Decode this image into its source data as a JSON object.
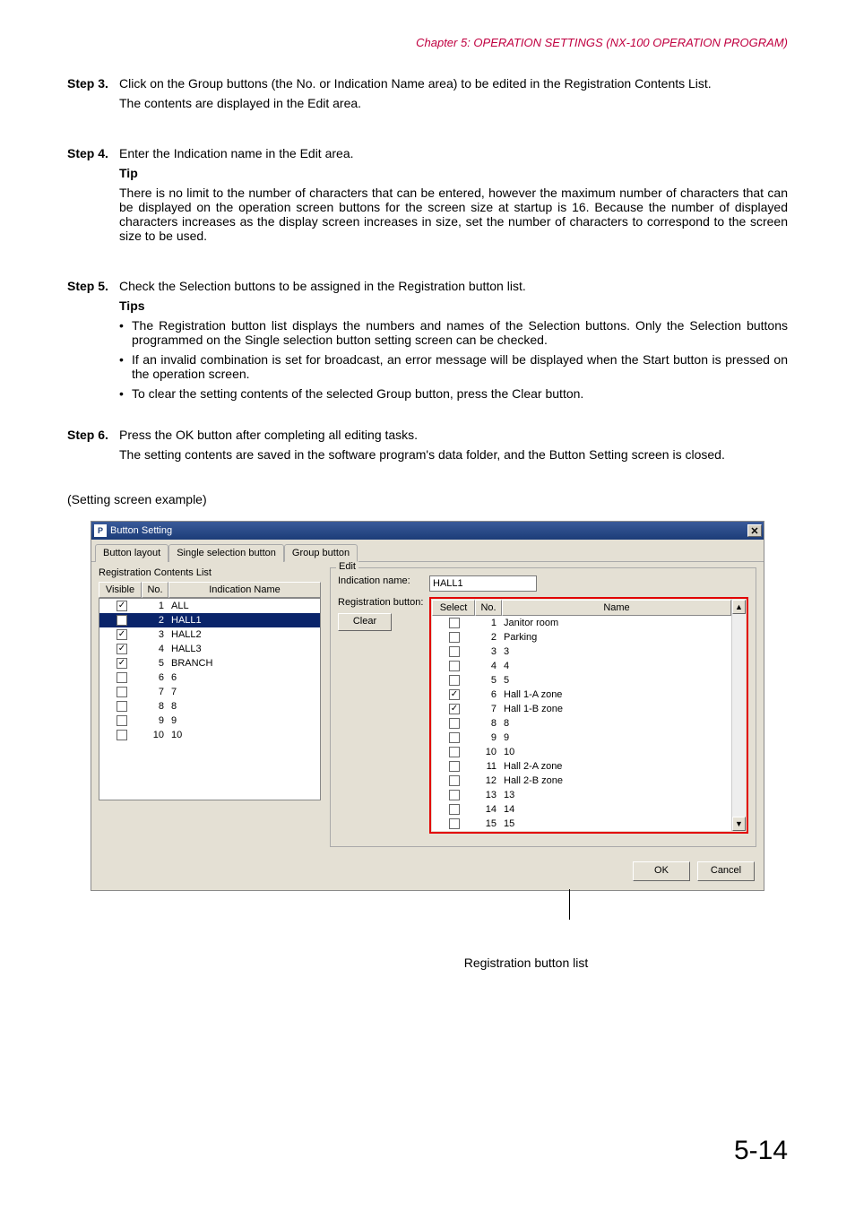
{
  "chapter": "Chapter 5:  OPERATION SETTINGS (NX-100 OPERATION PROGRAM)",
  "step3": {
    "label": "Step 3.",
    "p1": "Click on the Group buttons (the No. or Indication Name area) to be edited in the Registration Contents List.",
    "p2": "The contents are displayed in the Edit area."
  },
  "step4": {
    "label": "Step 4.",
    "p1": "Enter the Indication name in the Edit area.",
    "tip_label": "Tip",
    "tip_text": "There is no limit to the number of characters that can be entered, however the maximum number of characters that can be displayed on the operation screen buttons for the screen size at startup is 16. Because the number of displayed characters increases as the display screen increases in size, set the number of characters to correspond to the screen size to be used."
  },
  "step5": {
    "label": "Step 5.",
    "p1": "Check the Selection buttons to be assigned in the Registration button list.",
    "tips_label": "Tips",
    "b1": "The Registration button list displays the numbers and names of the Selection buttons. Only the Selection buttons programmed on the Single selection button setting screen can be checked.",
    "b2": "If an invalid combination is set for broadcast, an error message will be displayed when the Start button is pressed on the operation screen.",
    "b3": "To clear the setting contents of the selected Group button, press the Clear button."
  },
  "step6": {
    "label": "Step 6.",
    "p1": "Press the OK button after completing all editing tasks.",
    "p2": "The setting contents are saved in the software program's data folder, and the Button Setting screen is closed."
  },
  "example_label": "(Setting screen example)",
  "dialog": {
    "title": "Button Setting",
    "close_x": "✕",
    "tabs": {
      "layout": "Button layout",
      "single": "Single selection button",
      "group": "Group button"
    },
    "left": {
      "label": "Registration Contents List",
      "headers": {
        "visible": "Visible",
        "no": "No.",
        "name": "Indication Name"
      },
      "rows": [
        {
          "checked": true,
          "no": "1",
          "name": "ALL",
          "selected": false
        },
        {
          "checked": true,
          "no": "2",
          "name": "HALL1",
          "selected": true
        },
        {
          "checked": true,
          "no": "3",
          "name": "HALL2",
          "selected": false
        },
        {
          "checked": true,
          "no": "4",
          "name": "HALL3",
          "selected": false
        },
        {
          "checked": true,
          "no": "5",
          "name": "BRANCH",
          "selected": false
        },
        {
          "checked": false,
          "no": "6",
          "name": "6",
          "selected": false
        },
        {
          "checked": false,
          "no": "7",
          "name": "7",
          "selected": false
        },
        {
          "checked": false,
          "no": "8",
          "name": "8",
          "selected": false
        },
        {
          "checked": false,
          "no": "9",
          "name": "9",
          "selected": false
        },
        {
          "checked": false,
          "no": "10",
          "name": "10",
          "selected": false
        }
      ]
    },
    "edit": {
      "legend": "Edit",
      "indication_label": "Indication name:",
      "indication_value": "HALL1",
      "reg_label": "Registration button:",
      "clear_label": "Clear",
      "headers": {
        "select": "Select",
        "no": "No.",
        "name": "Name"
      },
      "rows": [
        {
          "checked": false,
          "no": "1",
          "name": "Janitor room"
        },
        {
          "checked": false,
          "no": "2",
          "name": "Parking"
        },
        {
          "checked": false,
          "no": "3",
          "name": "3"
        },
        {
          "checked": false,
          "no": "4",
          "name": "4"
        },
        {
          "checked": false,
          "no": "5",
          "name": "5"
        },
        {
          "checked": true,
          "no": "6",
          "name": "Hall 1-A zone"
        },
        {
          "checked": true,
          "no": "7",
          "name": "Hall 1-B zone"
        },
        {
          "checked": false,
          "no": "8",
          "name": "8"
        },
        {
          "checked": false,
          "no": "9",
          "name": "9"
        },
        {
          "checked": false,
          "no": "10",
          "name": "10"
        },
        {
          "checked": false,
          "no": "11",
          "name": "Hall 2-A zone"
        },
        {
          "checked": false,
          "no": "12",
          "name": "Hall 2-B zone"
        },
        {
          "checked": false,
          "no": "13",
          "name": "13"
        },
        {
          "checked": false,
          "no": "14",
          "name": "14"
        },
        {
          "checked": false,
          "no": "15",
          "name": "15"
        }
      ]
    },
    "footer": {
      "ok": "OK",
      "cancel": "Cancel"
    }
  },
  "callout_label": "Registration button list",
  "page_number": "5-14"
}
